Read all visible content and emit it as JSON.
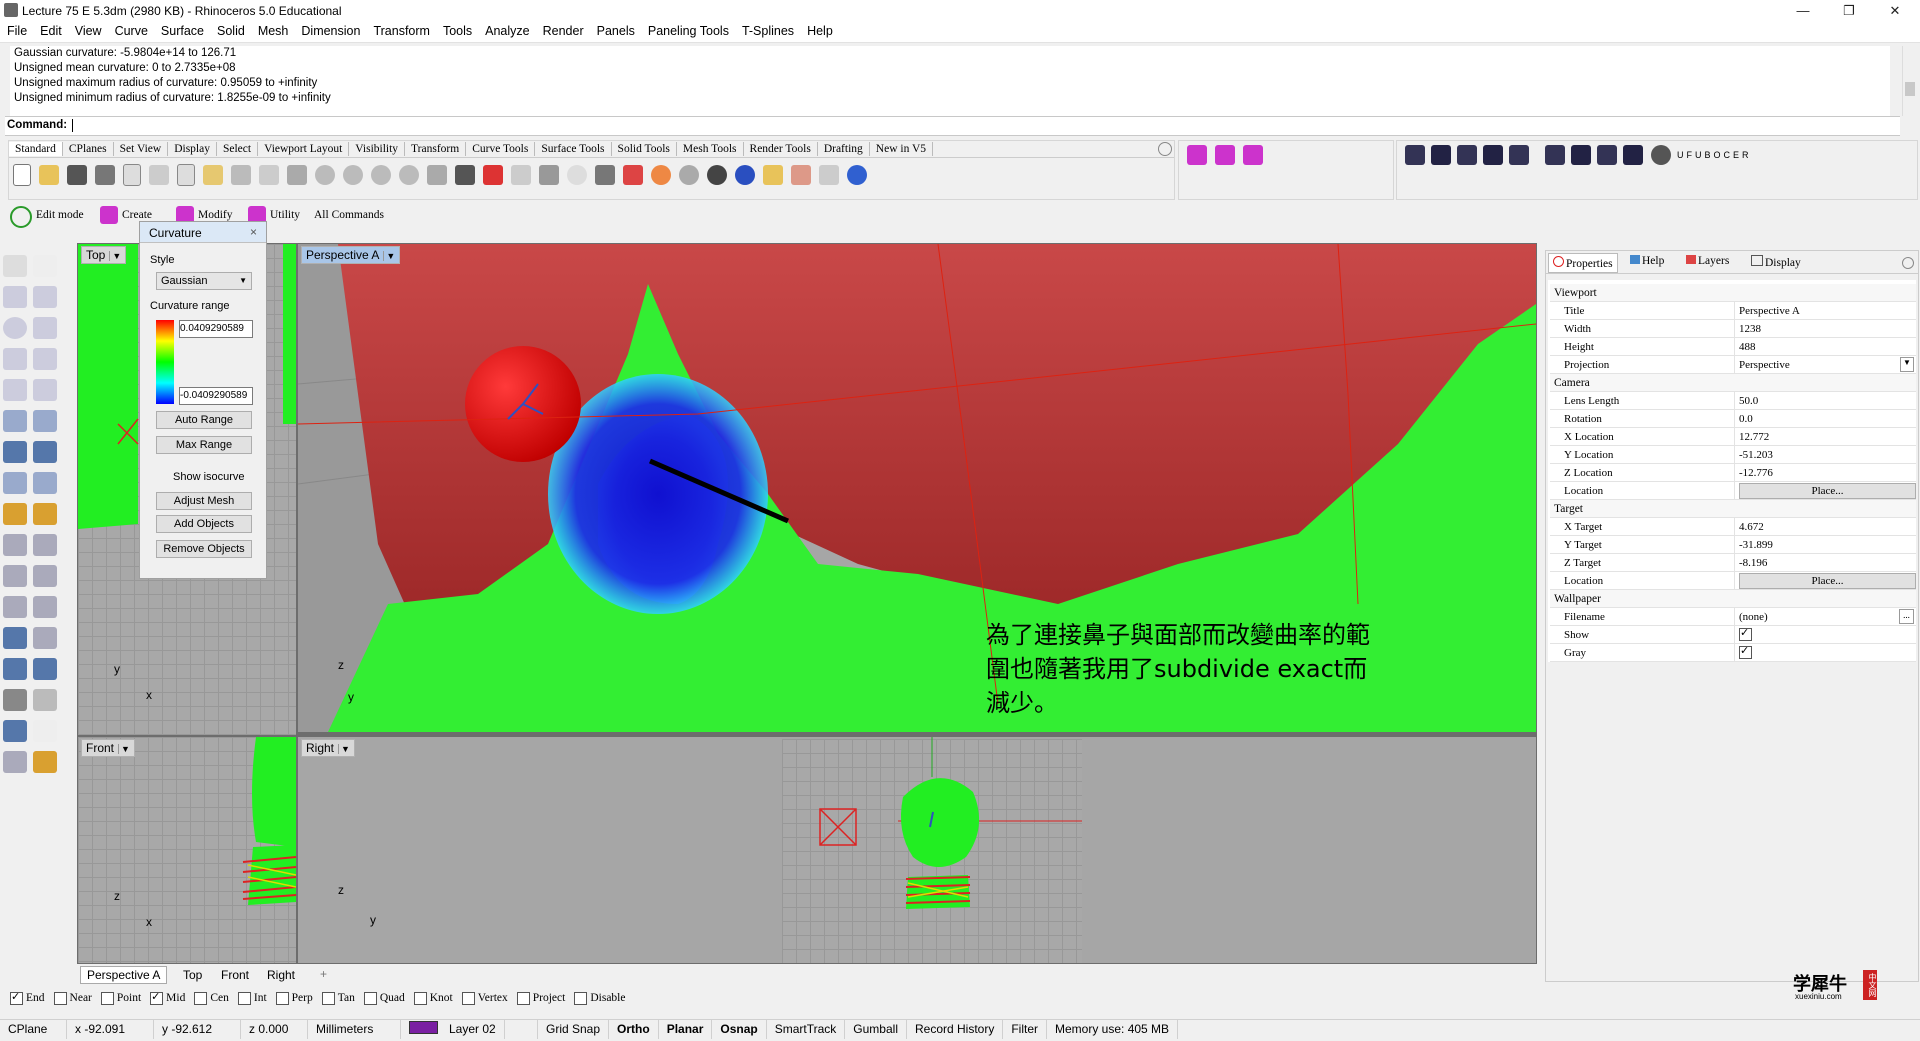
{
  "window": {
    "title": "Lecture 75 E 5.3dm (2980 KB) - Rhinoceros 5.0 Educational",
    "min": "—",
    "max": "❐",
    "close": "✕"
  },
  "menu": [
    "File",
    "Edit",
    "View",
    "Curve",
    "Surface",
    "Solid",
    "Mesh",
    "Dimension",
    "Transform",
    "Tools",
    "Analyze",
    "Render",
    "Panels",
    "Paneling Tools",
    "T-Splines",
    "Help"
  ],
  "command_history": [
    "Gaussian curvature: -5.9804e+14 to 126.71",
    "Unsigned mean curvature: 0 to 2.7335e+08",
    "Unsigned maximum radius of curvature: 0.95059 to +infinity",
    "Unsigned minimum radius of curvature: 1.8255e-09 to +infinity"
  ],
  "command_label": "Command:",
  "toolbar_tabs": [
    "Standard",
    "CPlanes",
    "Set View",
    "Display",
    "Select",
    "Viewport Layout",
    "Visibility",
    "Transform",
    "Curve Tools",
    "Surface Tools",
    "Solid Tools",
    "Mesh Tools",
    "Render Tools",
    "Drafting",
    "New in V5"
  ],
  "ufuboceer_label": "UFUBOCER",
  "secondary_toolbar": {
    "edit_mode": "Edit mode",
    "create": "Create",
    "modify": "Modify",
    "utility": "Utility",
    "all_commands": "All Commands"
  },
  "curvature_panel": {
    "title": "Curvature",
    "close": "×",
    "style_label": "Style",
    "style_value": "Gaussian",
    "range_label": "Curvature range",
    "range_max": "0.0409290589",
    "range_min": "-0.0409290589",
    "auto_range": "Auto Range",
    "max_range": "Max Range",
    "show_isocurve": "Show isocurve",
    "adjust_mesh": "Adjust Mesh",
    "add_objects": "Add Objects",
    "remove_objects": "Remove Objects"
  },
  "viewports": {
    "top": "Top",
    "perspective": "Perspective A",
    "front": "Front",
    "right": "Right"
  },
  "annotation": "為了連接鼻子與面部而改變曲率的範圍也隨著我用了subdivide exact而減少。",
  "axis": {
    "x": "x",
    "y": "y",
    "z": "z"
  },
  "viewport_tabs": [
    "Perspective A",
    "Top",
    "Front",
    "Right"
  ],
  "viewport_tab_add": "+",
  "panel_tabs": [
    "Properties",
    "Help",
    "Layers",
    "Display"
  ],
  "properties": {
    "viewport_section": "Viewport",
    "rows1": [
      [
        "Title",
        "Perspective A"
      ],
      [
        "Width",
        "1238"
      ],
      [
        "Height",
        "488"
      ],
      [
        "Projection",
        "Perspective"
      ]
    ],
    "camera_section": "Camera",
    "rows2": [
      [
        "Lens Length",
        "50.0"
      ],
      [
        "Rotation",
        "0.0"
      ],
      [
        "X Location",
        "12.772"
      ],
      [
        "Y Location",
        "-51.203"
      ],
      [
        "Z Location",
        "-12.776"
      ],
      [
        "Location",
        "Place..."
      ]
    ],
    "target_section": "Target",
    "rows3": [
      [
        "X Target",
        "4.672"
      ],
      [
        "Y Target",
        "-31.899"
      ],
      [
        "Z Target",
        "-8.196"
      ],
      [
        "Location",
        "Place..."
      ]
    ],
    "wallpaper_section": "Wallpaper",
    "filename_label": "Filename",
    "filename_value": "(none)",
    "filename_button": "...",
    "show_label": "Show",
    "gray_label": "Gray"
  },
  "osnap": [
    {
      "label": "End",
      "checked": true
    },
    {
      "label": "Near",
      "checked": false
    },
    {
      "label": "Point",
      "checked": false
    },
    {
      "label": "Mid",
      "checked": true
    },
    {
      "label": "Cen",
      "checked": false
    },
    {
      "label": "Int",
      "checked": false
    },
    {
      "label": "Perp",
      "checked": false
    },
    {
      "label": "Tan",
      "checked": false
    },
    {
      "label": "Quad",
      "checked": false
    },
    {
      "label": "Knot",
      "checked": false
    },
    {
      "label": "Vertex",
      "checked": false
    },
    {
      "label": "Project",
      "checked": false
    },
    {
      "label": "Disable",
      "checked": false
    }
  ],
  "status": {
    "cplane": "CPlane",
    "x": "x -92.091",
    "y": "y -92.612",
    "z": "z 0.000",
    "units": "Millimeters",
    "layer": "Layer 02",
    "layer_color": "#7a1fa2",
    "grid_snap": "Grid Snap",
    "ortho": "Ortho",
    "planar": "Planar",
    "osnap": "Osnap",
    "smarttrack": "SmartTrack",
    "gumball": "Gumball",
    "record_history": "Record History",
    "filter": "Filter",
    "memory": "Memory use: 405 MB"
  },
  "watermark": {
    "cn": "学犀牛",
    "url": "xuexiniu.com",
    "badge": "中文网"
  }
}
